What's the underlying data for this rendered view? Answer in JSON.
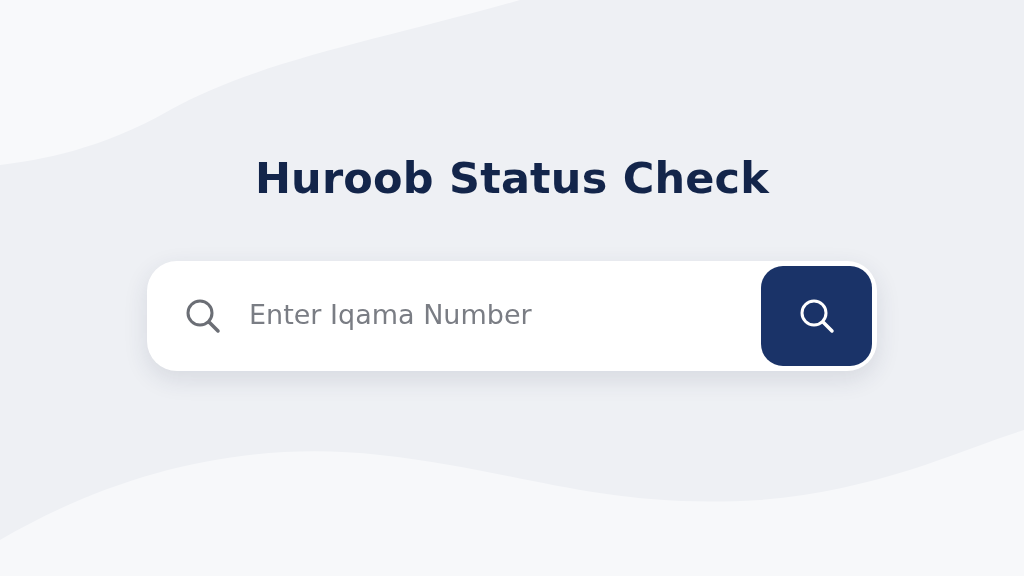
{
  "title": "Huroob Status Check",
  "search": {
    "placeholder": "Enter Iqama Number"
  }
}
